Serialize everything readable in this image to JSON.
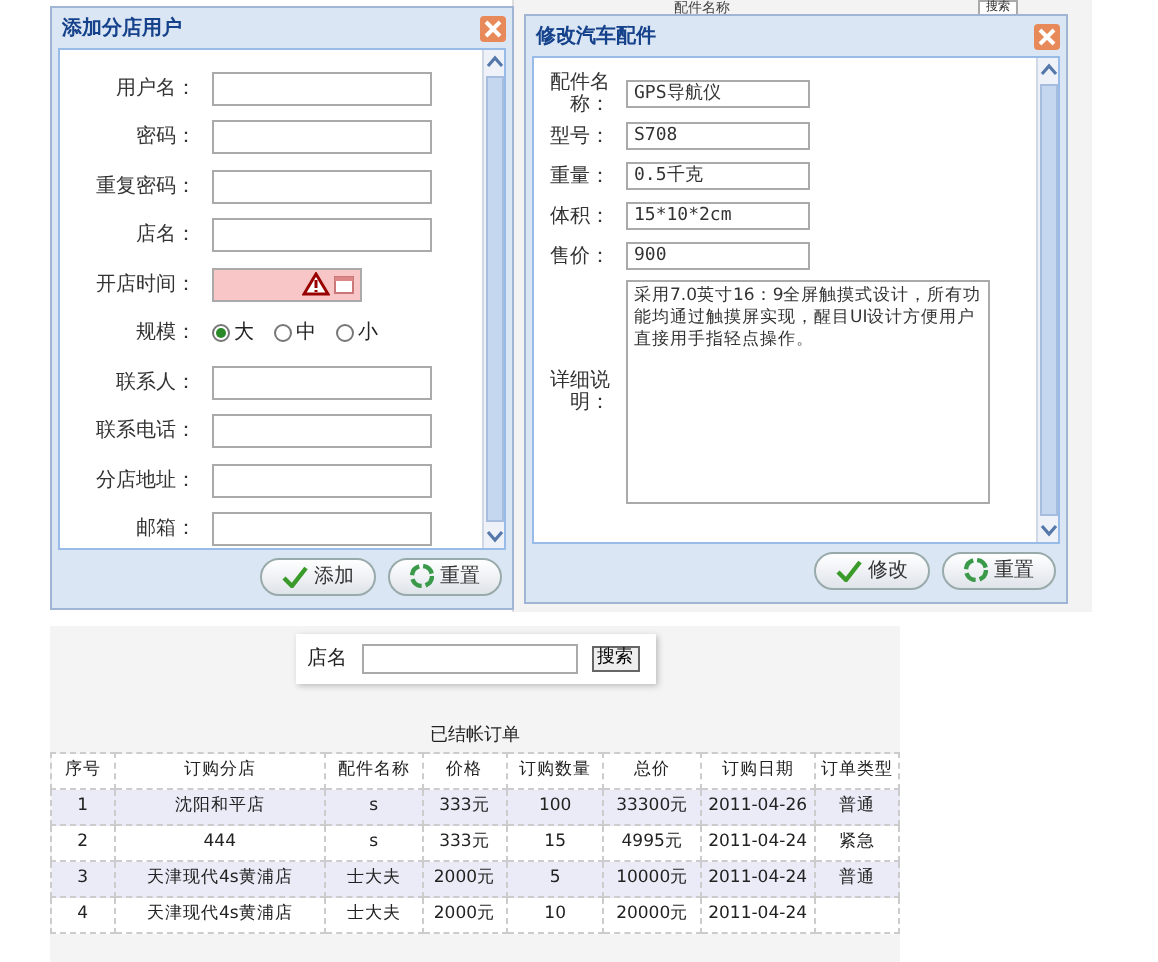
{
  "background_page": {
    "column_header": "配件名称",
    "search_button": "搜索"
  },
  "add_dialog": {
    "title": "添加分店用户",
    "fields": [
      {
        "kind": "text",
        "label": "用户名："
      },
      {
        "kind": "text",
        "label": "密码："
      },
      {
        "kind": "text",
        "label": "重复密码："
      },
      {
        "kind": "text",
        "label": "店名："
      },
      {
        "kind": "date",
        "label": "开店时间：",
        "invalid": true
      },
      {
        "kind": "radio",
        "label": "规模：",
        "options": [
          {
            "label": "大",
            "selected": true
          },
          {
            "label": "中",
            "selected": false
          },
          {
            "label": "小",
            "selected": false
          }
        ]
      },
      {
        "kind": "text",
        "label": "联系人："
      },
      {
        "kind": "text",
        "label": "联系电话："
      },
      {
        "kind": "text",
        "label": "分店地址："
      },
      {
        "kind": "text",
        "label": "邮箱："
      }
    ],
    "buttons": [
      {
        "kind": "confirm",
        "label": "添加"
      },
      {
        "kind": "reset",
        "label": "重置"
      }
    ]
  },
  "edit_dialog": {
    "title": "修改汽车配件",
    "fields": [
      {
        "kind": "text",
        "label": "配件名称：",
        "value": "GPS导航仪"
      },
      {
        "kind": "text",
        "label": "型号：",
        "value": "S708"
      },
      {
        "kind": "text",
        "label": "重量：",
        "value": "0.5千克"
      },
      {
        "kind": "text",
        "label": "体积：",
        "value": "15*10*2cm"
      },
      {
        "kind": "text",
        "label": "售价：",
        "value": "900"
      },
      {
        "kind": "textarea",
        "label": "详细说明：",
        "value": "采用7.0英寸16：9全屏触摸式设计，所有功能均通过触摸屏实现，醒目UI设计方便用户直接用手指轻点操作。"
      }
    ],
    "buttons": [
      {
        "kind": "confirm",
        "label": "修改"
      },
      {
        "kind": "reset",
        "label": "重置"
      }
    ]
  },
  "orders": {
    "search": {
      "label": "店名",
      "button": "搜索"
    },
    "caption": "已结帐订单",
    "columns": [
      "序号",
      "订购分店",
      "配件名称",
      "价格",
      "订购数量",
      "总价",
      "订购日期",
      "订单类型"
    ],
    "rows": [
      [
        "1",
        "沈阳和平店",
        "s",
        "333元",
        "100",
        "33300元",
        "2011-04-26",
        "普通"
      ],
      [
        "2",
        "444",
        "s",
        "333元",
        "15",
        "4995元",
        "2011-04-24",
        "紧急"
      ],
      [
        "3",
        "天津现代4s黄浦店",
        "士大夫",
        "2000元",
        "5",
        "10000元",
        "2011-04-24",
        "普通"
      ],
      [
        "4",
        "天津现代4s黄浦店",
        "士大夫",
        "2000元",
        "10",
        "20000元",
        "2011-04-24",
        null
      ]
    ]
  }
}
